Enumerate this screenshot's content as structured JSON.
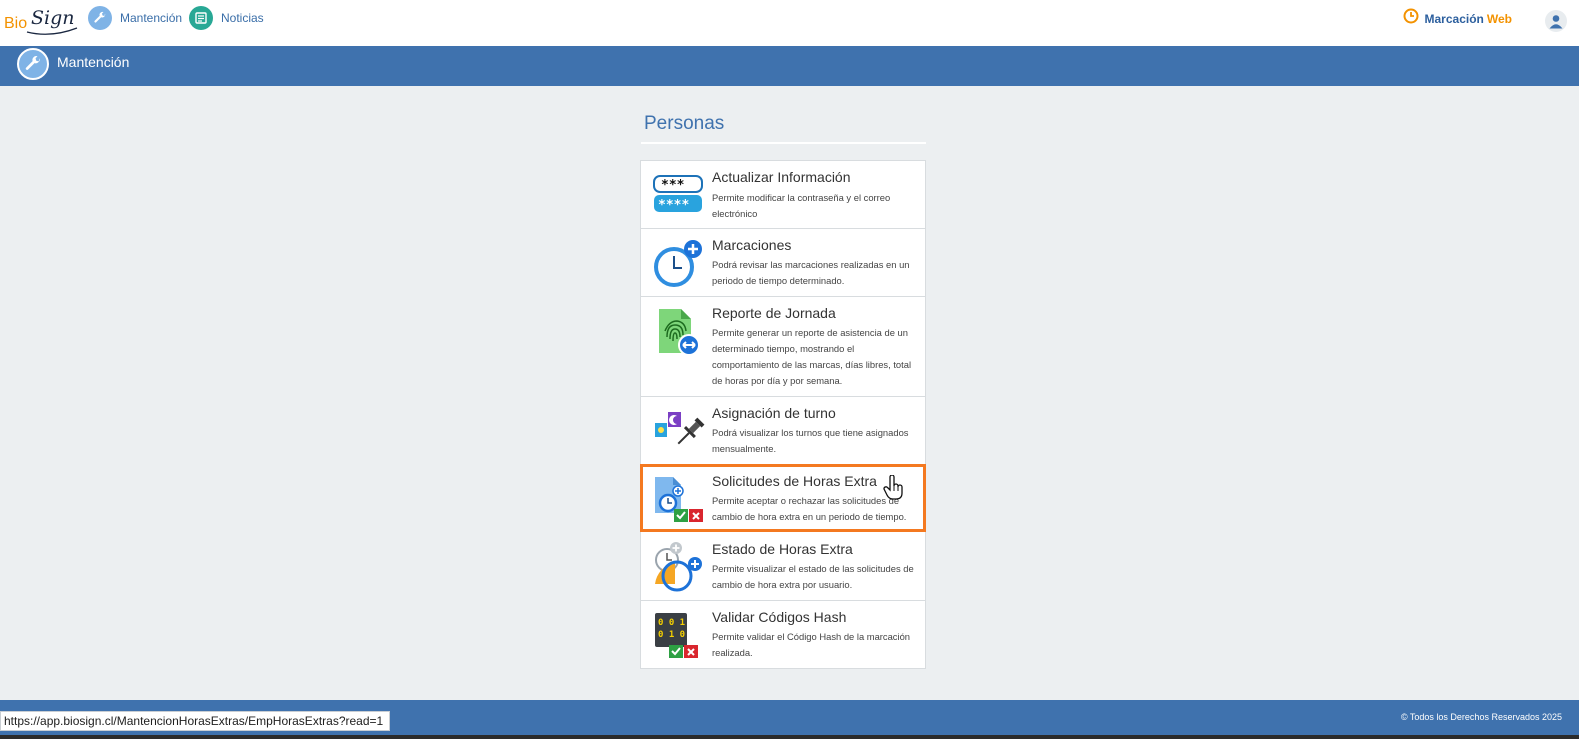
{
  "nav": {
    "logo_left": "Bio",
    "logo_right": "Sign",
    "items": [
      {
        "label": "Mantención",
        "icon": "wrench-icon"
      },
      {
        "label": "Noticias",
        "icon": "news-icon"
      }
    ],
    "marcacion_label": "Marcación",
    "marcacion_accent": "Web"
  },
  "header": {
    "title": "Mantención"
  },
  "section": {
    "title": "Personas"
  },
  "cards": [
    {
      "title": "Actualizar Información",
      "desc": "Permite modificar la contraseña y el correo electrónico",
      "icon": "password-icon"
    },
    {
      "title": "Marcaciones",
      "desc": "Podrá revisar las marcaciones realizadas en un periodo de tiempo determinado.",
      "icon": "clock-plus-icon"
    },
    {
      "title": "Reporte de Jornada",
      "desc": "Permite generar un reporte de asistencia de un determinado tiempo, mostrando el comportamiento de las marcas, días libres, total de horas por día y por semana.",
      "icon": "fingerprint-report-icon"
    },
    {
      "title": "Asignación de turno",
      "desc": "Podrá visualizar los turnos que tiene asignados mensualmente.",
      "icon": "shift-pin-icon"
    },
    {
      "title": "Solicitudes de Horas Extra",
      "desc": "Permite aceptar o rechazar las solicitudes de cambio de hora extra en un periodo de tiempo.",
      "icon": "overtime-request-icon"
    },
    {
      "title": "Estado de Horas Extra",
      "desc": "Permite visualizar el estado de las solicitudes de cambio de hora extra por usuario.",
      "icon": "overtime-status-icon"
    },
    {
      "title": "Validar Códigos Hash",
      "desc": "Permite validar el Código Hash de la marcación realizada.",
      "icon": "hash-validate-icon"
    }
  ],
  "footer": {
    "copyright": "© Todos los Derechos Reservados 2025",
    "status_url": "https://app.biosign.cl/MantencionHorasExtras/EmpHorasExtras?read=1"
  },
  "colors": {
    "brand_blue": "#3f72ae",
    "accent_orange": "#f39200",
    "highlight": "#f47920"
  }
}
